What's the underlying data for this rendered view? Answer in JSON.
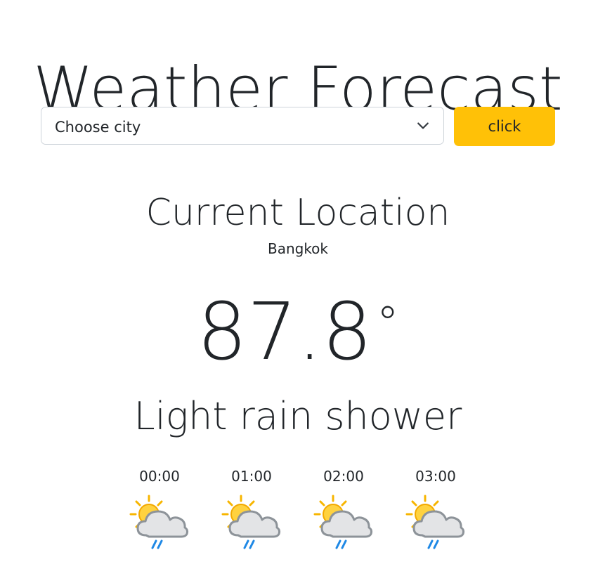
{
  "header": {
    "title": "Weather Forecast"
  },
  "controls": {
    "city_select_value": "Choose city",
    "button_label": "click"
  },
  "current": {
    "heading": "Current Location",
    "city": "Bangkok",
    "temperature": "87.8",
    "degree_symbol": "°",
    "condition": "Light rain shower"
  },
  "hourly": [
    {
      "time": "00:00",
      "icon": "light-rain-shower-icon"
    },
    {
      "time": "01:00",
      "icon": "light-rain-shower-icon"
    },
    {
      "time": "02:00",
      "icon": "light-rain-shower-icon"
    },
    {
      "time": "03:00",
      "icon": "light-rain-shower-icon"
    }
  ],
  "colors": {
    "button_bg": "#ffc107",
    "text": "#212529",
    "border": "#ced4da",
    "sun": "#f7b500",
    "rain": "#1e88e5"
  }
}
